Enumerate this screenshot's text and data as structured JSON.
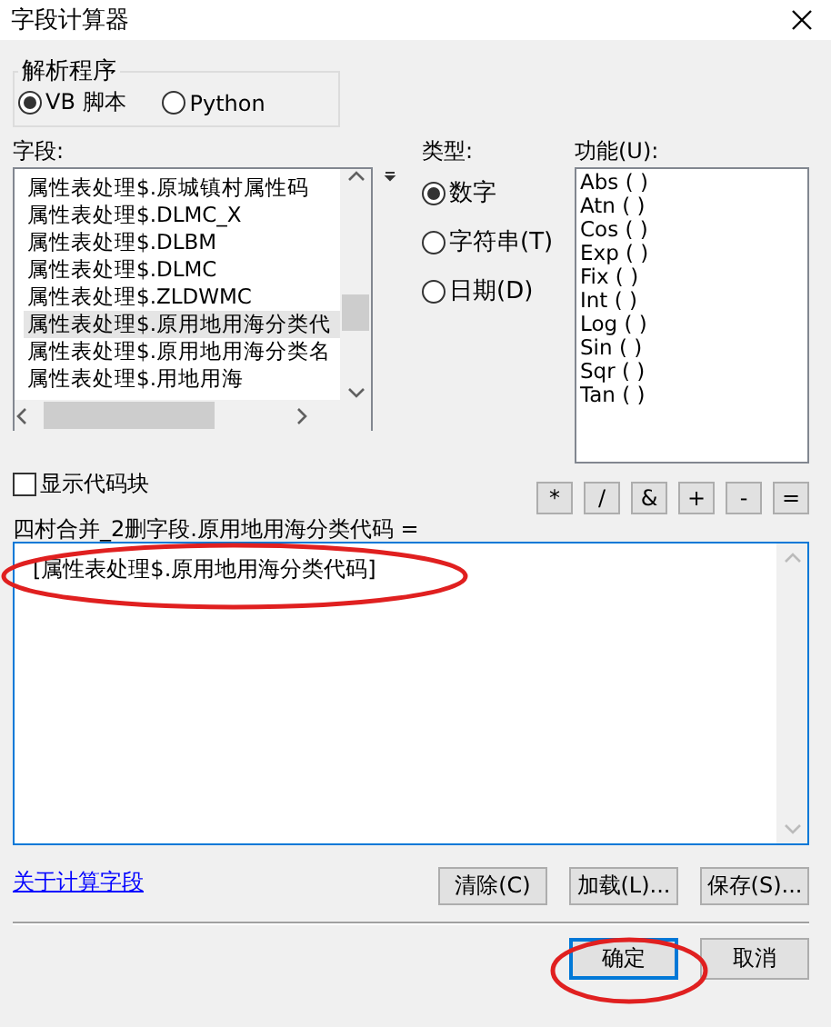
{
  "window": {
    "title": "字段计算器"
  },
  "parser": {
    "label": "解析程序",
    "options": [
      {
        "label": "VB 脚本",
        "selected": true
      },
      {
        "label": "Python",
        "selected": false
      }
    ]
  },
  "fields": {
    "label": "字段:",
    "items": [
      {
        "text": "属性表处理$.原城镇村属性码",
        "selected": false
      },
      {
        "text": "属性表处理$.DLMC_X",
        "selected": false
      },
      {
        "text": "属性表处理$.DLBM",
        "selected": false
      },
      {
        "text": "属性表处理$.DLMC",
        "selected": false
      },
      {
        "text": "属性表处理$.ZLDWMC",
        "selected": false
      },
      {
        "text": "属性表处理$.原用地用海分类代",
        "selected": true
      },
      {
        "text": "属性表处理$.原用地用海分类名",
        "selected": false
      },
      {
        "text": "属性表处理$.用地用海",
        "selected": false
      }
    ]
  },
  "type": {
    "label": "类型:",
    "options": [
      {
        "label": "数字",
        "selected": true
      },
      {
        "label": "字符串(T)",
        "selected": false
      },
      {
        "label": "日期(D)",
        "selected": false
      }
    ]
  },
  "functions": {
    "label": "功能(U):",
    "items": [
      "Abs ( )",
      "Atn ( )",
      "Cos ( )",
      "Exp ( )",
      "Fix ( )",
      "Int ( )",
      "Log ( )",
      "Sin ( )",
      "Sqr ( )",
      "Tan ( )"
    ]
  },
  "show_code_block": {
    "label": "显示代码块",
    "checked": false
  },
  "operators": [
    "*",
    "/",
    "&",
    "+",
    "-",
    "="
  ],
  "expression": {
    "label": "四村合并_2删字段.原用地用海分类代码 =",
    "value": "[属性表处理$.原用地用海分类代码]"
  },
  "help_link": "关于计算字段",
  "file_buttons": [
    "清除(C)",
    "加载(L)...",
    "保存(S)..."
  ],
  "dialog_buttons": [
    {
      "label": "确定",
      "focused": true
    },
    {
      "label": "取消",
      "focused": false
    }
  ]
}
